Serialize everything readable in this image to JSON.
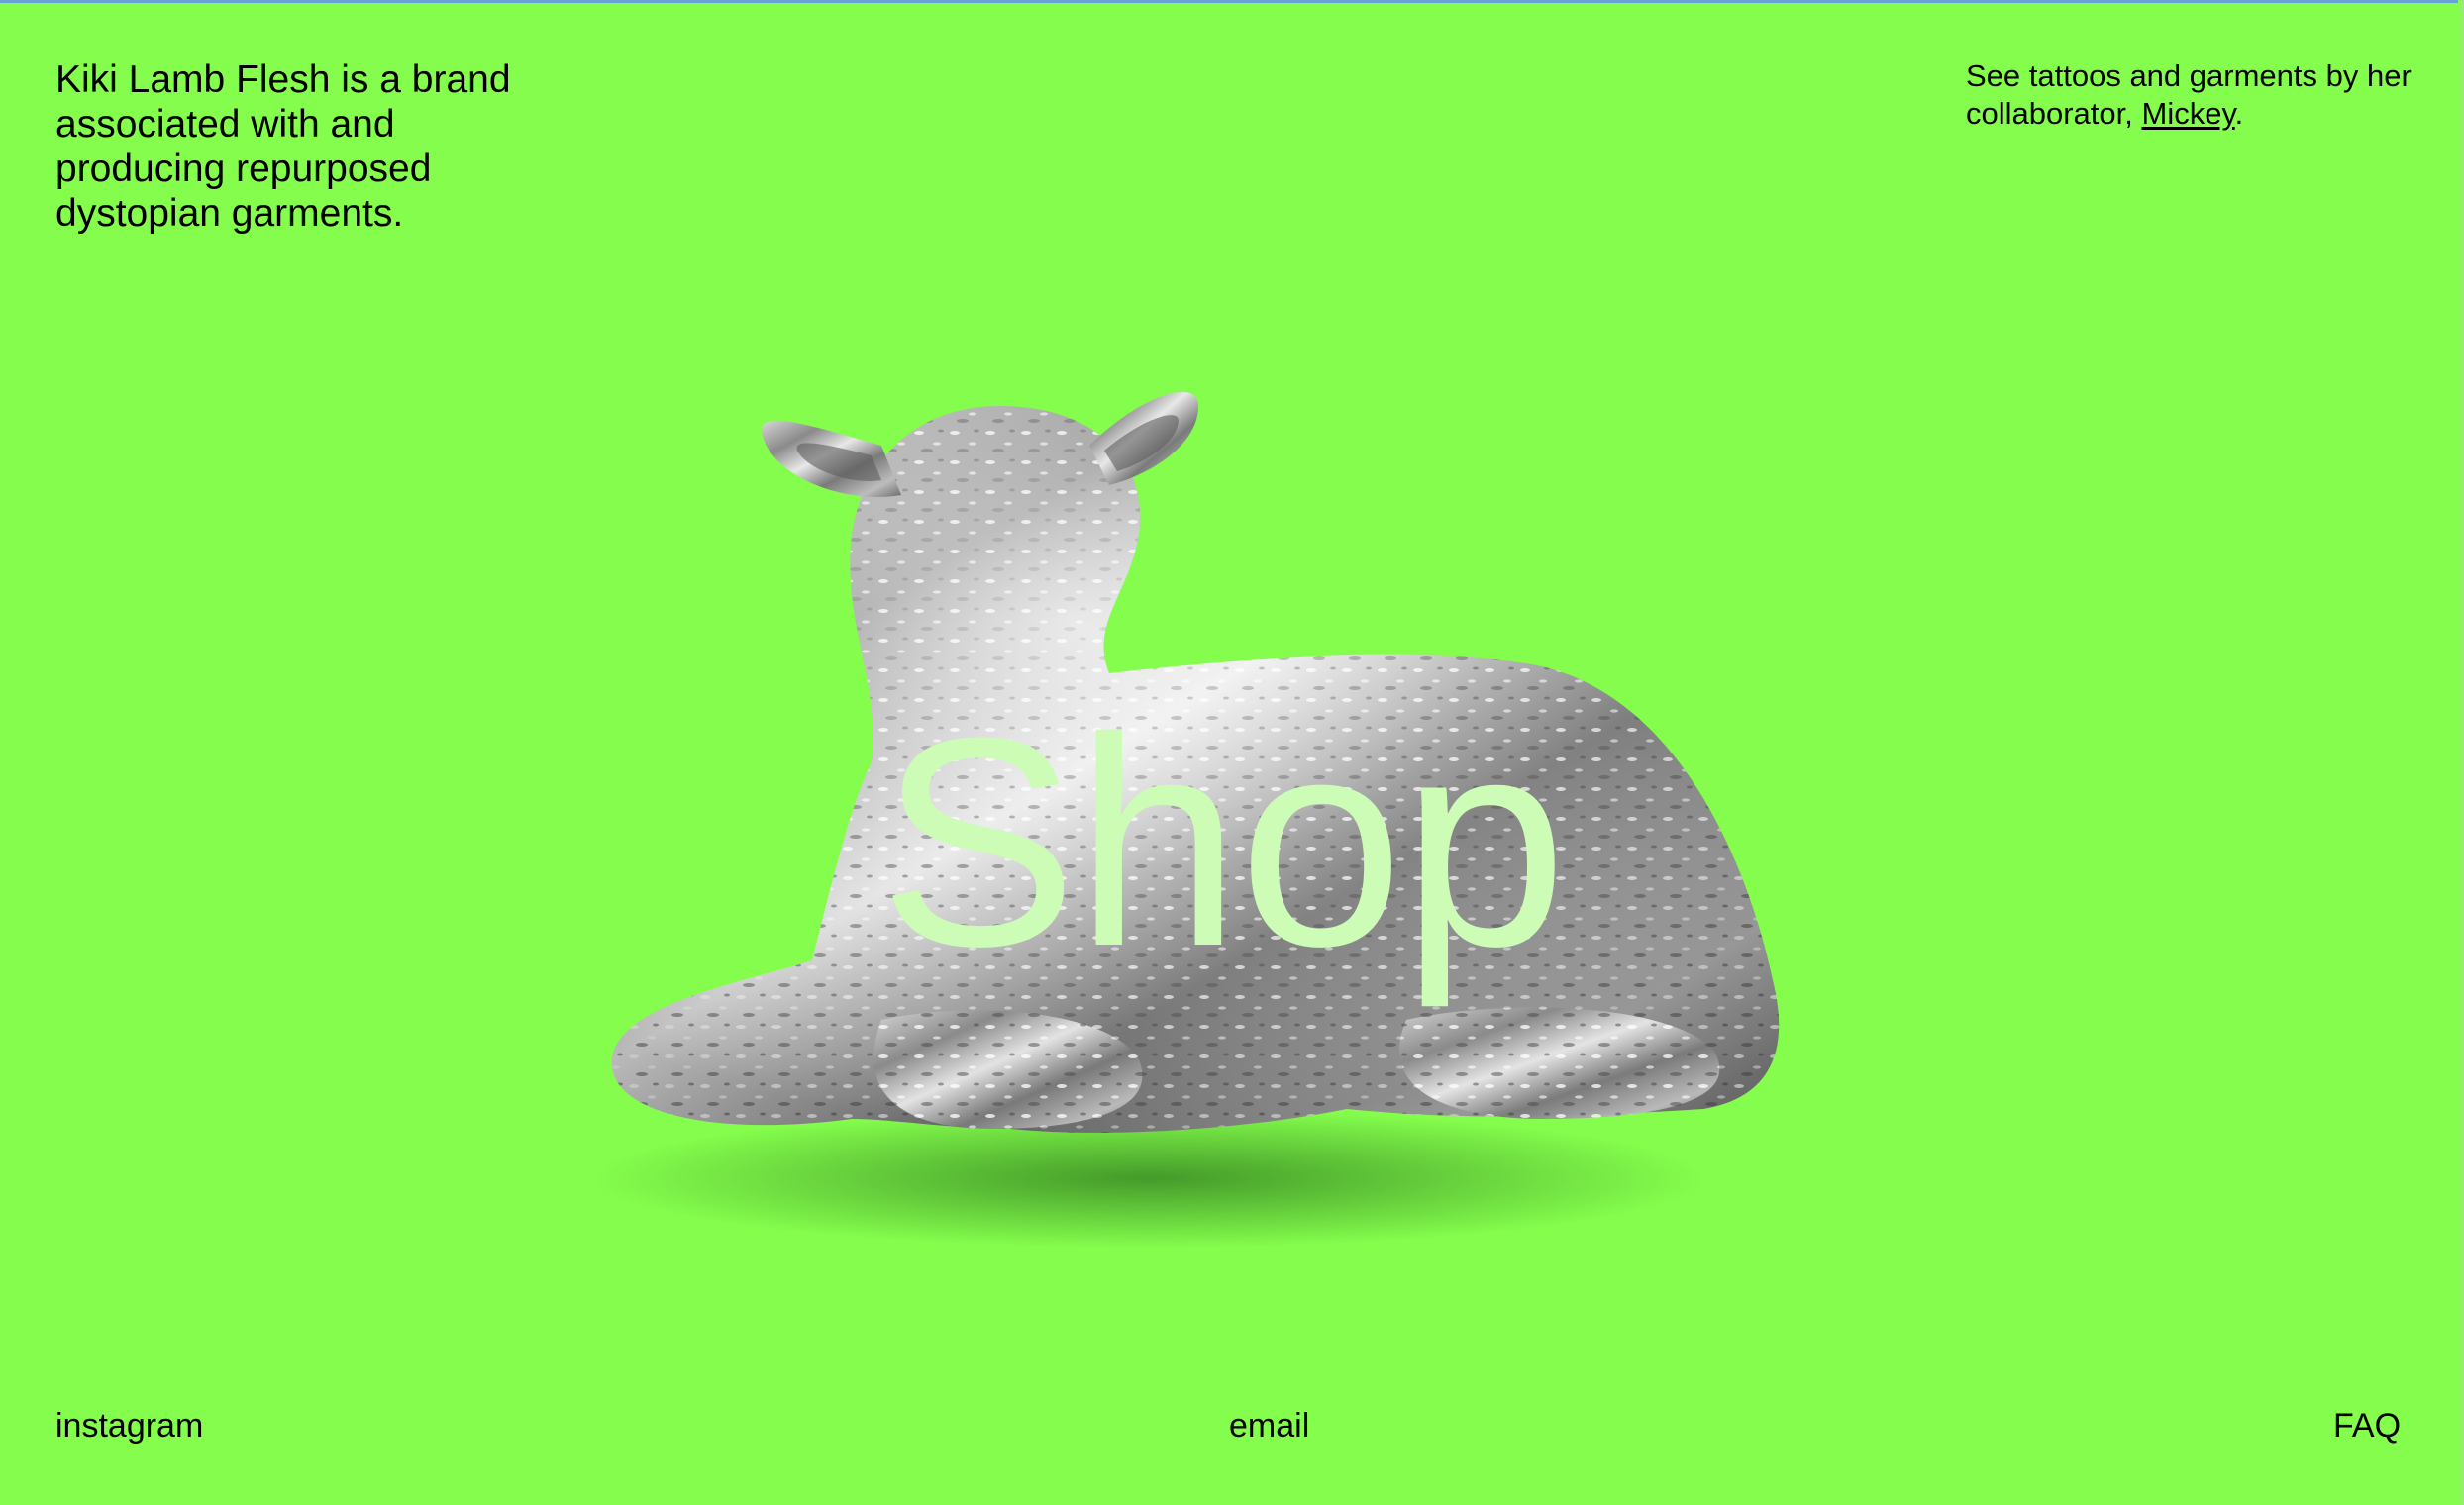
{
  "intro": {
    "text": "Kiki Lamb Flesh is a brand associated with and producing repurposed dystopian garments."
  },
  "collab": {
    "prefix": "See tattoos and garments by her collaborator, ",
    "link_label": "Mickey",
    "suffix": "."
  },
  "hero": {
    "shop_label": "Shop",
    "image_icon": "chrome-lamb-sculpture"
  },
  "footer": {
    "instagram_label": "instagram",
    "email_label": "email",
    "faq_label": "FAQ"
  },
  "colors": {
    "background": "#84fd4c",
    "shop_text": "#ccfcb6",
    "text": "#000000"
  }
}
